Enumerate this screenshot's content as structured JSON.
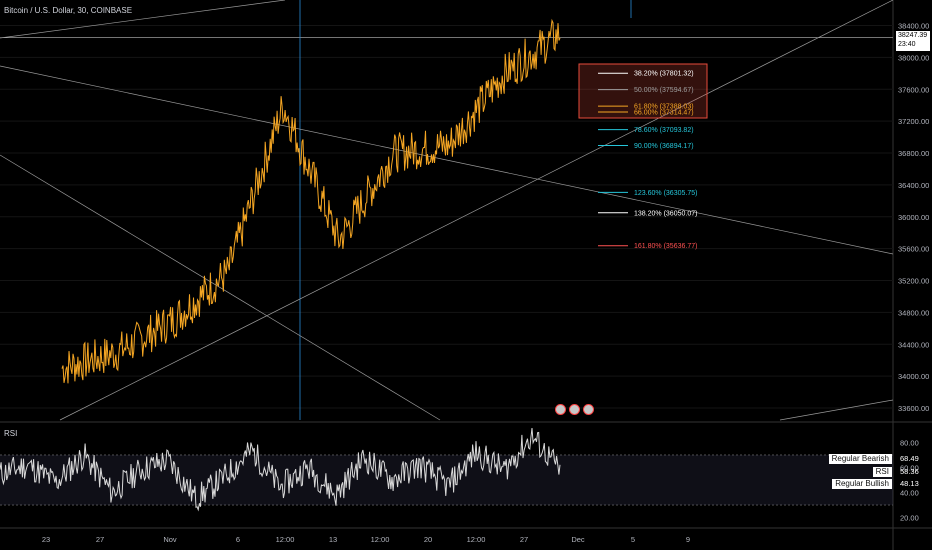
{
  "title": "Bitcoin / U.S. Dollar, 30, COINBASE",
  "rsi_label": "RSI",
  "price_tag": {
    "price": "38247.39",
    "countdown": "23:40"
  },
  "colors": {
    "candle": "#f5a623",
    "grid": "#1c1c1c",
    "trend": "#888888",
    "rsi": "#d9d9d9",
    "fib_box": "#e74c3c"
  },
  "chart_data": [
    {
      "type": "line",
      "title": "Bitcoin / U.S. Dollar, 30, COINBASE",
      "y_ticks": [
        38400,
        38000,
        37600,
        37200,
        36800,
        36400,
        36000,
        35600,
        35200,
        34800,
        34400,
        34000,
        33600
      ],
      "y_tick_labels": [
        "38400.00",
        "38000.00",
        "37600.00",
        "37200.00",
        "36800.00",
        "36400.00",
        "36000.00",
        "35600.00",
        "35200.00",
        "34800.00",
        "34400.00",
        "34000.00",
        "33600.00"
      ],
      "ylim": [
        33450,
        38720
      ],
      "x_ticks": [
        "23",
        "27",
        "Nov",
        "6",
        "12:00",
        "13",
        "12:00",
        "20",
        "12:00",
        "27",
        "Dec",
        "5",
        "9"
      ],
      "last_price": 38247.39,
      "series": [
        {
          "x": [
            "23",
            "27",
            "Nov",
            "6",
            "12:00",
            "13",
            "12:00",
            "20",
            "12:00",
            "27"
          ],
          "values": [
            34100,
            34300,
            34700,
            35300,
            37400,
            35700,
            36800,
            36900,
            37800,
            38300
          ]
        }
      ],
      "fib_levels": [
        {
          "label": "38.20% (37801.32)",
          "value": 37801.32,
          "color": "#ffffff"
        },
        {
          "label": "50.00% (37594.67)",
          "value": 37594.67,
          "color": "#9e9e9e"
        },
        {
          "label": "61.80% (37388.03)",
          "value": 37388.03,
          "color": "#f5a623"
        },
        {
          "label": "66.00% (37314.47)",
          "value": 37314.47,
          "color": "#f5a623"
        },
        {
          "label": "78.60% (37093.82)",
          "value": 37093.82,
          "color": "#26c6da"
        },
        {
          "label": "90.00% (36894.17)",
          "value": 36894.17,
          "color": "#26c6da"
        },
        {
          "label": "123.60% (36305.75)",
          "value": 36305.75,
          "color": "#26c6da"
        },
        {
          "label": "138.20% (36050.07)",
          "value": 36050.07,
          "color": "#ffffff"
        },
        {
          "label": "161.80% (35636.77)",
          "value": 35636.77,
          "color": "#ff5252"
        }
      ]
    },
    {
      "type": "line",
      "title": "RSI",
      "y_ticks": [
        80,
        60,
        40,
        20
      ],
      "y_tick_labels": [
        "80.00",
        "60.00",
        "40.00",
        "20.00"
      ],
      "ylim": [
        14,
        94
      ],
      "bands": [
        70,
        48.13,
        30
      ],
      "series": [
        {
          "name": "RSI",
          "values": [
            55,
            62,
            48,
            70,
            40,
            58,
            66,
            35,
            52,
            74,
            44,
            60,
            38,
            68,
            50,
            62,
            45,
            72,
            58,
            85,
            58
          ]
        }
      ],
      "legend": [
        {
          "label": "Regular Bearish",
          "value": "68.49"
        },
        {
          "label": "RSI",
          "value": "58.36"
        },
        {
          "label": "Regular Bullish",
          "value": "48.13"
        }
      ]
    }
  ]
}
